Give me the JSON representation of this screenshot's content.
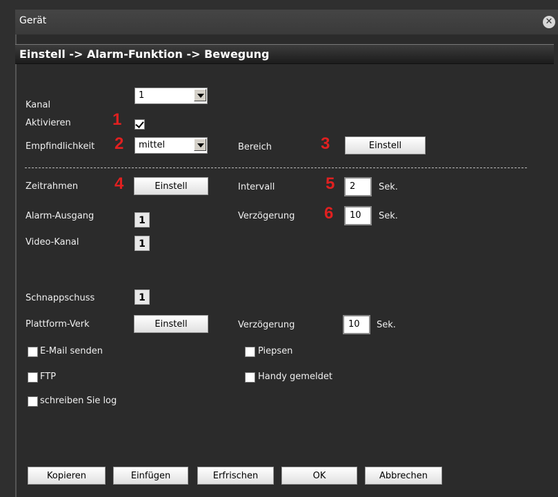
{
  "window": {
    "title": "Gerät",
    "close_icon": "close-icon"
  },
  "breadcrumb": "Einstell -> Alarm-Funktion -> Bewegung",
  "labels": {
    "kanal": "Kanal",
    "aktivieren": "Aktivieren",
    "empfindlichkeit": "Empfindlichkeit",
    "bereich": "Bereich",
    "zeitrahmen": "Zeitrahmen",
    "intervall": "Intervall",
    "alarm_ausgang": "Alarm-Ausgang",
    "verzoegerung": "Verzögerung",
    "video_kanal": "Video-Kanal",
    "schnappschuss": "Schnappschuss",
    "plattform_verk": "Plattform-Verk",
    "verzoegerung2": "Verzögerung",
    "sek": "Sek."
  },
  "markers": {
    "m1": "1",
    "m2": "2",
    "m3": "3",
    "m4": "4",
    "m5": "5",
    "m6": "6"
  },
  "fields": {
    "kanal_value": "1",
    "aktivieren_checked": true,
    "empfindlichkeit_value": "mittel",
    "intervall_value": "2",
    "verzoegerung_value": "10",
    "alarm_ausgang_value": "1",
    "video_kanal_value": "1",
    "schnappschuss_value": "1",
    "verzoegerung2_value": "10"
  },
  "buttons": {
    "bereich": "Einstell",
    "zeitrahmen": "Einstell",
    "plattform": "Einstell",
    "kopieren": "Kopieren",
    "einfuegen": "Einfügen",
    "erfrischen": "Erfrischen",
    "ok": "OK",
    "abbrechen": "Abbrechen"
  },
  "checkboxes": {
    "email": "E-Mail senden",
    "ftp": "FTP",
    "log": "schreiben Sie log",
    "piepsen": "Piepsen",
    "handy": "Handy gemeldet"
  },
  "colors": {
    "marker": "#e02020",
    "background": "#2b2b2b"
  }
}
